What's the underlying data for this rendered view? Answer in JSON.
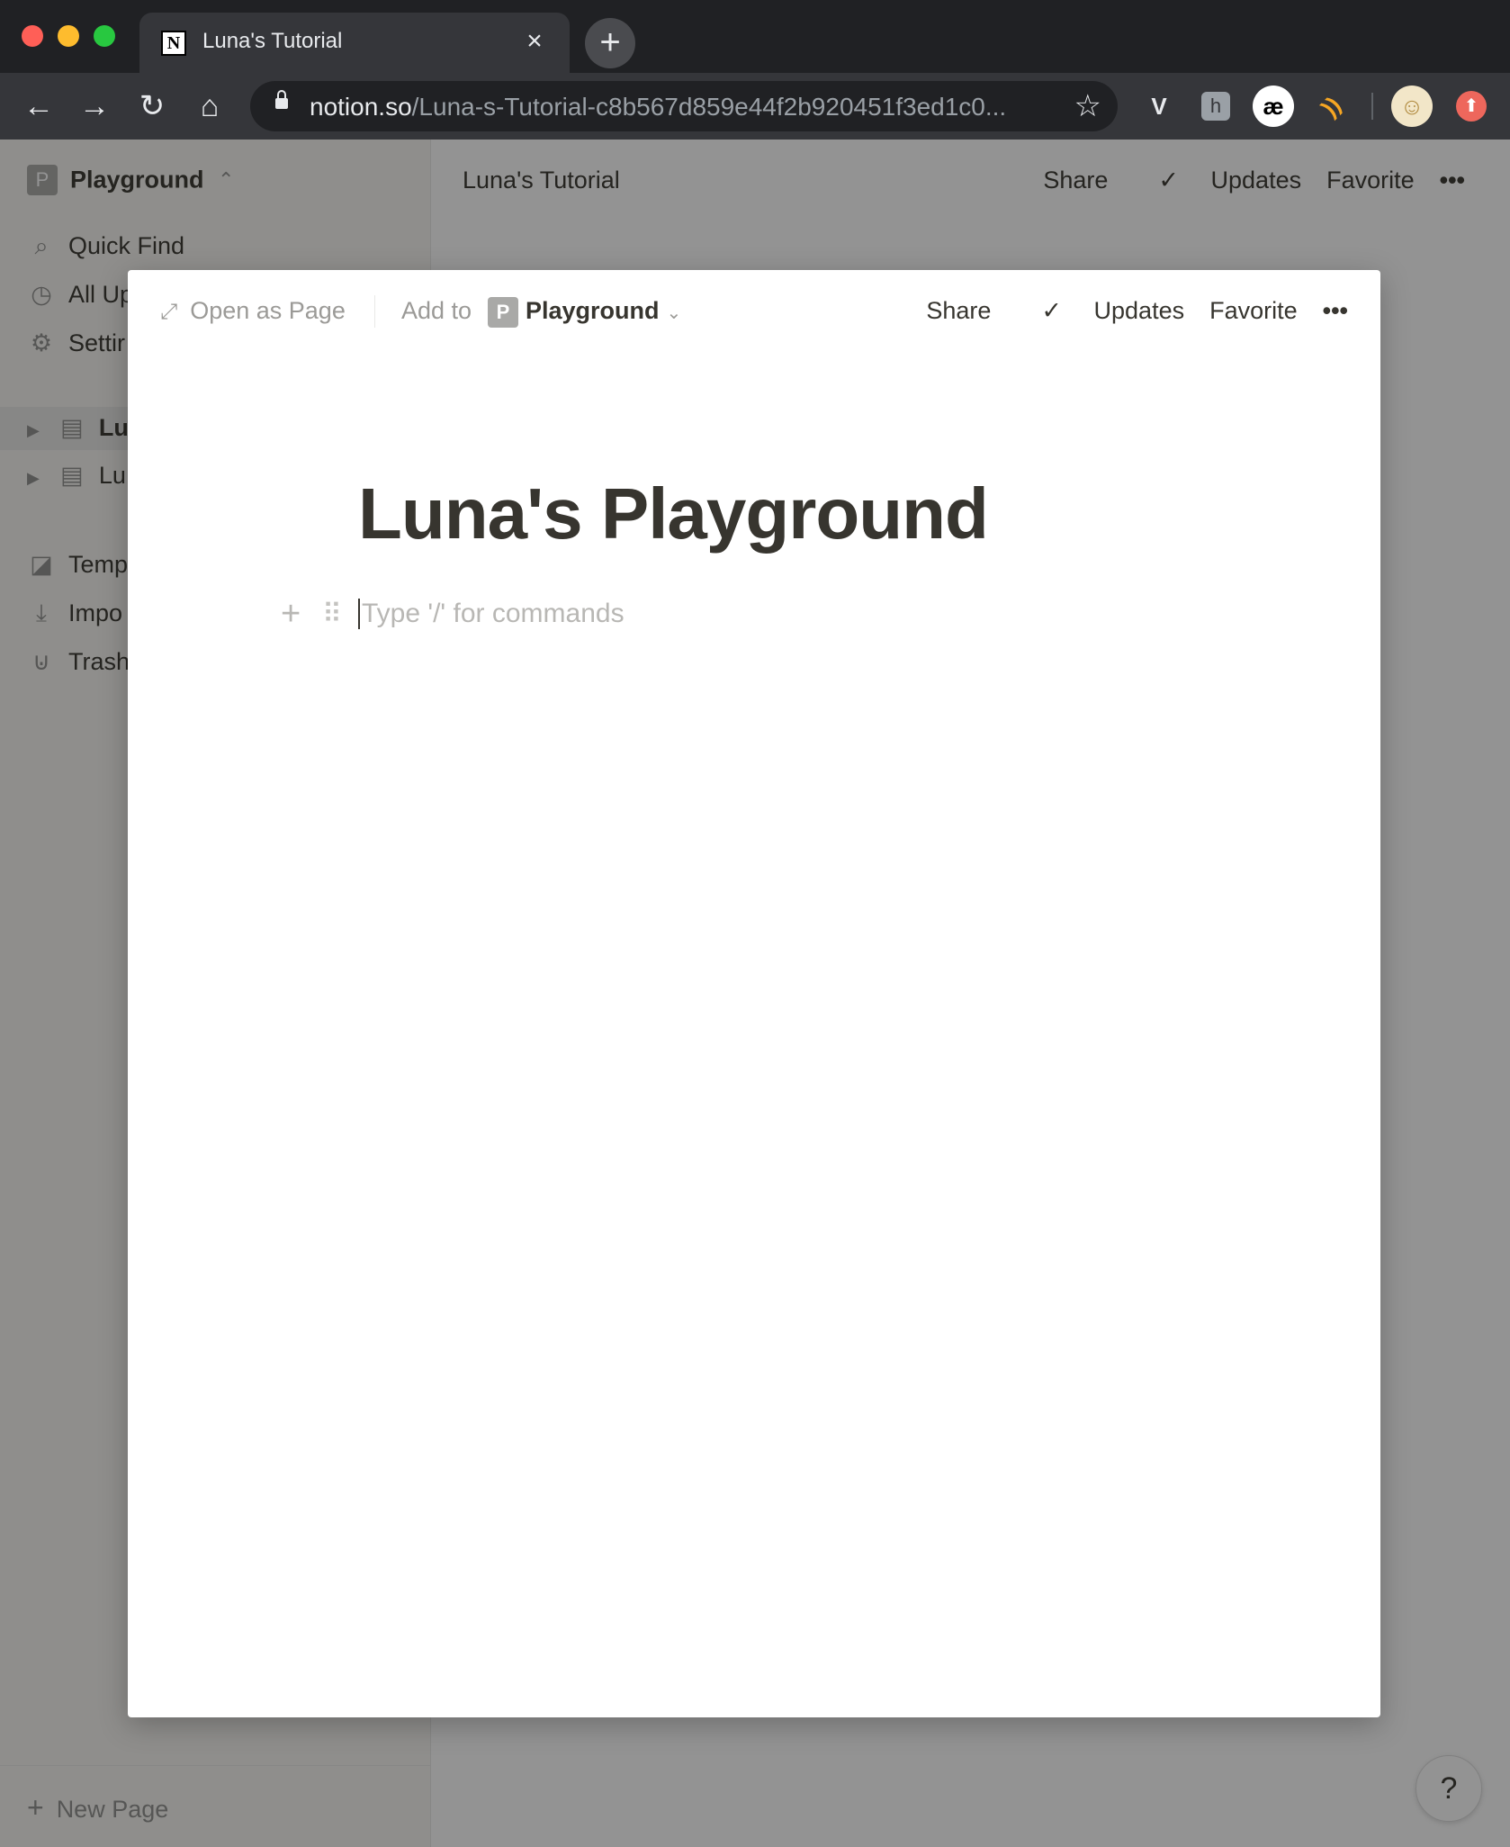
{
  "browser": {
    "tab_title": "Luna's Tutorial",
    "tab_close": "×",
    "new_tab": "+",
    "nav": {
      "back": "←",
      "forward": "→",
      "reload": "↻",
      "home": "⌂"
    },
    "url_domain": "notion.so",
    "url_path": "/Luna-s-Tutorial-c8b567d859e44f2b920451f3ed1c0...",
    "bookmark_star": "☆",
    "extensions": [
      {
        "icon": "vivaldi-v-icon",
        "glyph": "V"
      },
      {
        "icon": "hypothesis-icon",
        "glyph": "h"
      },
      {
        "icon": "ae-icon",
        "glyph": "æ"
      },
      {
        "icon": "rss-icon",
        "glyph": "))"
      },
      {
        "icon": "profile-avatar-icon",
        "glyph": "☺"
      },
      {
        "icon": "update-icon",
        "glyph": "⬆"
      }
    ]
  },
  "sidebar": {
    "workspace_badge": "P",
    "workspace_name": "Playground",
    "workspace_chevron": "⌃",
    "items": [
      {
        "label": "Quick Find",
        "icon": "⌕"
      },
      {
        "label": "All Up",
        "icon": "◷"
      },
      {
        "label": "Settir",
        "icon": "⚙"
      }
    ],
    "pages": [
      {
        "label": "Lu",
        "toggle": "▶",
        "icon": "▤"
      },
      {
        "label": "Lu",
        "toggle": "▶",
        "icon": "▤"
      }
    ],
    "bottom_items": [
      {
        "label": "Temp",
        "icon": "◪"
      },
      {
        "label": "Impo",
        "icon": "⤓"
      },
      {
        "label": "Trash",
        "icon": "⊍"
      }
    ],
    "new_page": "New Page",
    "new_page_icon": "+"
  },
  "topbar": {
    "title": "Luna's Tutorial",
    "share": "Share",
    "updates": "Updates",
    "favorite": "Favorite",
    "more": "•••"
  },
  "modal": {
    "open_as_page": "Open as Page",
    "add_to": "Add to",
    "workspace_badge": "P",
    "workspace_name": "Playground",
    "share": "Share",
    "updates": "Updates",
    "favorite": "Favorite",
    "more": "•••",
    "title": "Luna's Playground",
    "placeholder": "Type '/' for commands"
  },
  "help": "?",
  "colors": {
    "chrome_dark": "#202124",
    "chrome_tab": "#35363a",
    "notion_text": "#37352f",
    "notion_muted": "#9b9a97",
    "sidebar_bg": "#f7f6f3"
  }
}
